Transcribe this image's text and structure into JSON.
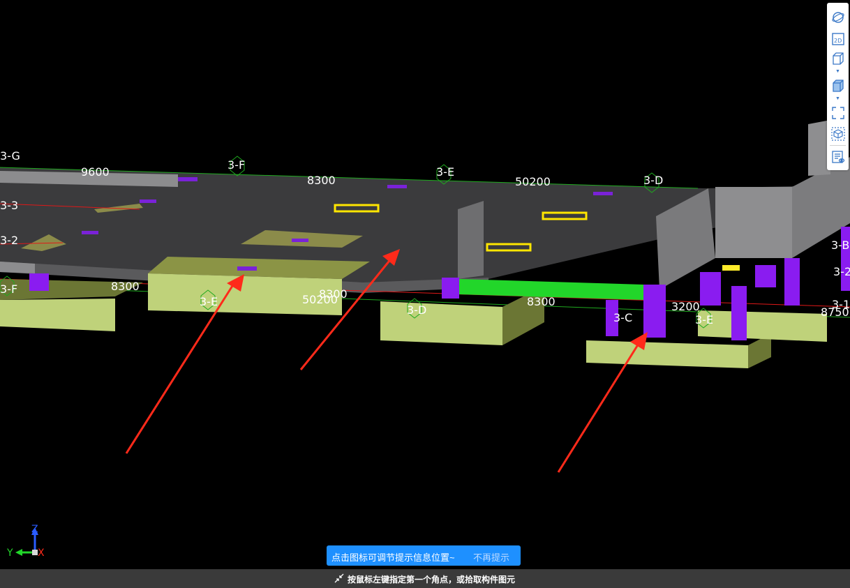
{
  "scene": {
    "axis_labels": [
      "3-G",
      "3-F",
      "3-E",
      "3-D",
      "3-B",
      "3-3",
      "3-2",
      "3-F",
      "3-E",
      "3-D",
      "3-C",
      "3-E",
      "3-2",
      "3-1"
    ],
    "dimensions": [
      "9600",
      "8300",
      "50200",
      "8300",
      "50200",
      "8300",
      "8300",
      "3200",
      "8750"
    ]
  },
  "triad": {
    "z": "Z",
    "y": "Y",
    "x": "X"
  },
  "toolbar": {
    "items": [
      "orbit-icon",
      "2d-view-icon",
      "3d-wireframe-icon",
      "3d-solid-icon",
      "fullscreen-icon",
      "isolate-component-icon",
      "properties-list-icon"
    ]
  },
  "tip": {
    "text": "点击图标可调节提示信息位置~",
    "dismiss": "不再提示"
  },
  "status": {
    "text": "按鼠标左键指定第一个角点，或拾取构件图元"
  },
  "colors": {
    "background": "#000000",
    "slab": "#3b3b3d",
    "footing": "#bfd27a",
    "column": "#8a1cf0",
    "beam_highlight": "#22d62a",
    "arrow": "#ff2a1a",
    "tip_bg": "#1e90ff",
    "status_bg": "#3a3a3a"
  }
}
